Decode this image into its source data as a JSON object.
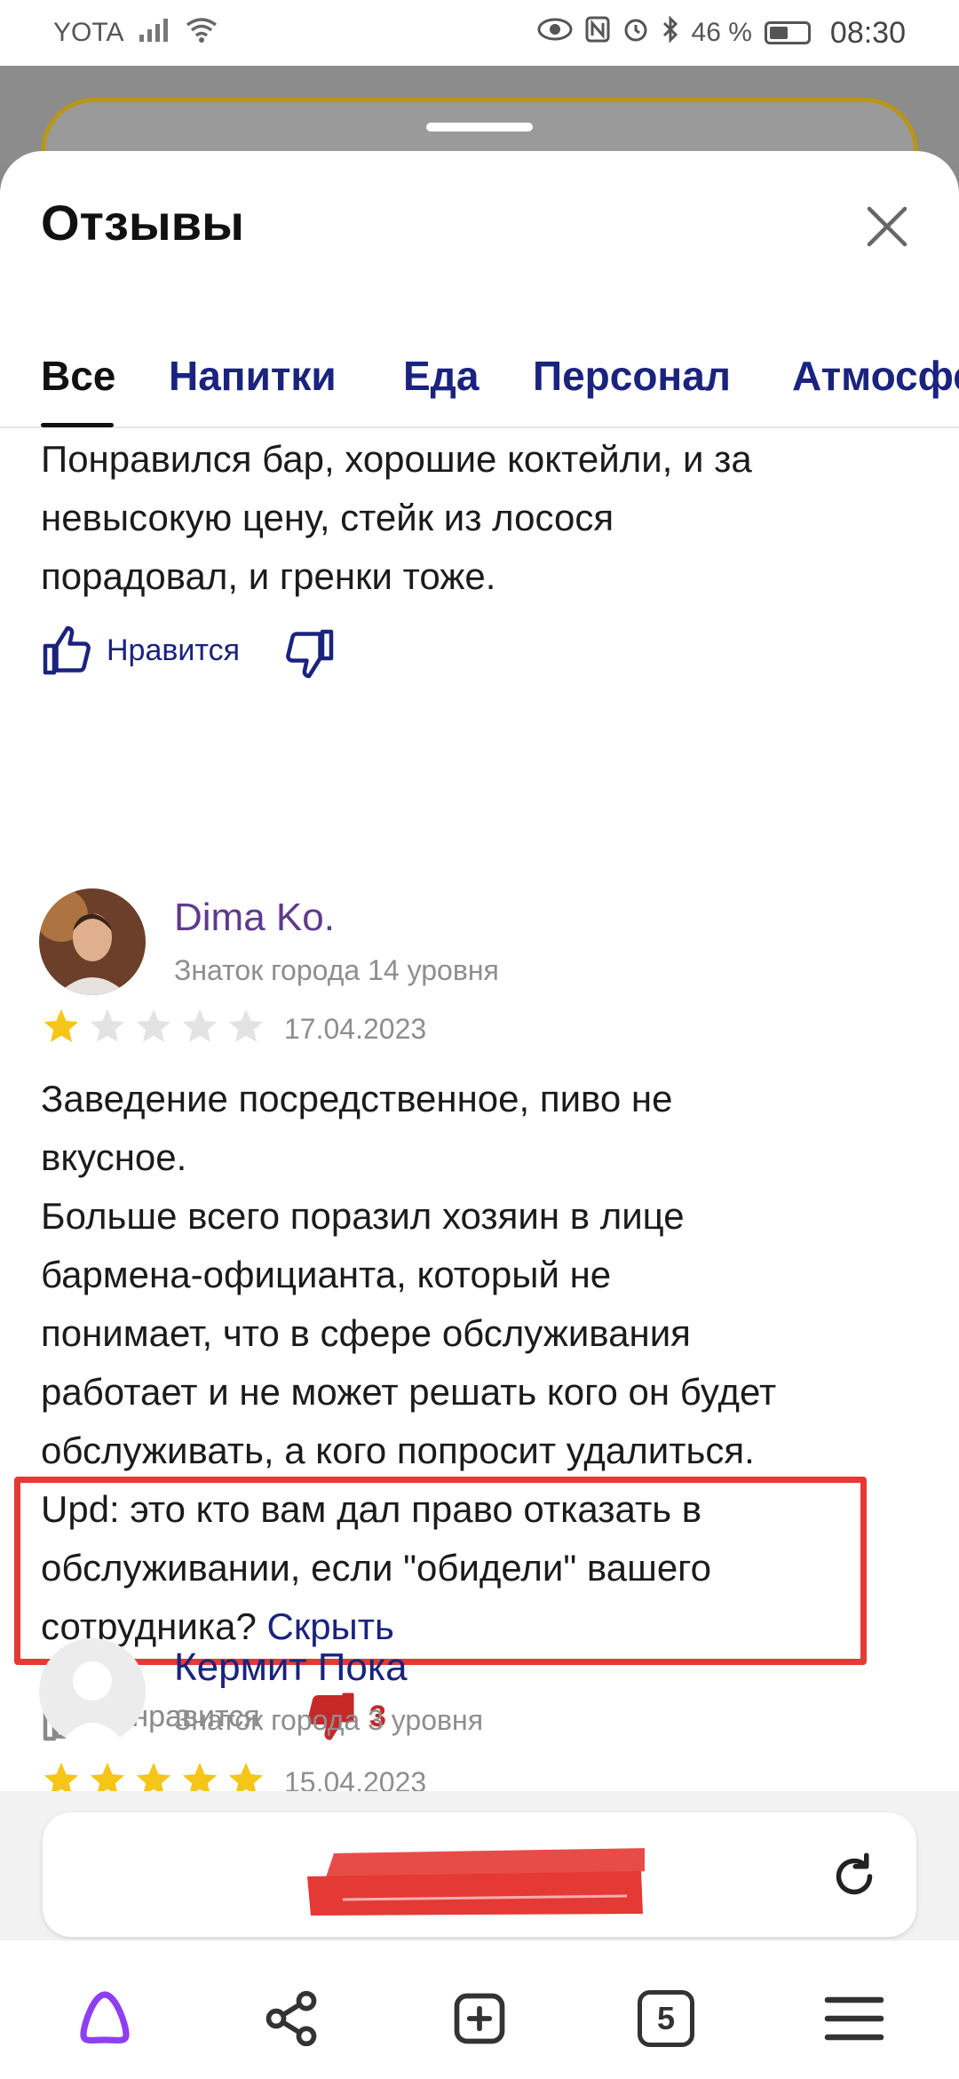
{
  "status_bar": {
    "carrier": "YOTA",
    "battery": "46 %",
    "time": "08:30"
  },
  "sheet": {
    "title": "Отзывы",
    "tabs": [
      "Все",
      "Напитки",
      "Еда",
      "Персонал",
      "Атмосфе"
    ]
  },
  "reviews": [
    {
      "text_lines": [
        "Понравился бар, хорошие коктейли, и за",
        "невысокую цену, стейк из лосося",
        "порадовал, и гренки тоже."
      ],
      "like_label": "Нравится"
    },
    {
      "author": "Dima Ko.",
      "level": "Знаток города 14 уровня",
      "rating": 1,
      "date": "17.04.2023",
      "text_lines": [
        "Заведение посредственное, пиво не",
        "вкусное.",
        "Больше всего поразил хозяин в лице",
        "бармена-официанта, который не",
        "понимает, что в сфере обслуживания",
        "работает и не может решать кого он будет",
        "обслуживать, а кого попросит удалиться.",
        "Upd: это кто вам дал право отказать в",
        "обслуживании, если \"обидели\" вашего",
        "сотрудника?"
      ],
      "hide_link": "Скрыть",
      "likes_label": "2 нравится",
      "dislikes": "3"
    },
    {
      "author": "Кермит Пока",
      "level": "Знаток города 3 уровня",
      "rating": 5,
      "date": "15.04.2023"
    }
  ],
  "colors": {
    "accent_navy": "#1a237e",
    "author_purple": "#5e3a8c",
    "star_yellow": "#f5c518",
    "highlight_red": "#e53935"
  },
  "bottom_nav": {
    "tabs_count": "5"
  }
}
